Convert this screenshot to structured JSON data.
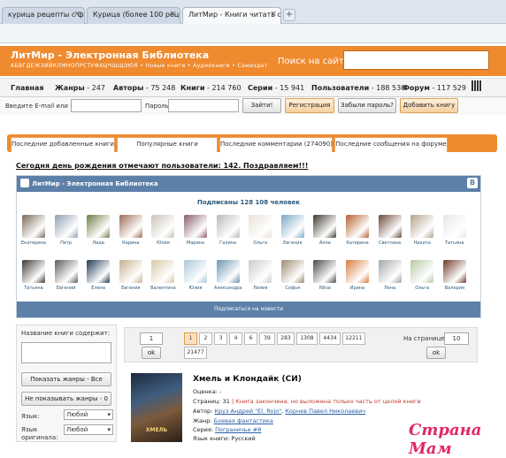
{
  "browser": {
    "tabs": [
      {
        "title": "курица рецепты с фото"
      },
      {
        "title": "Курица (более 100 рецеп"
      },
      {
        "title": "ЛитМир - Книги читать он"
      }
    ],
    "new_tab": "+"
  },
  "site": {
    "title": "ЛитМир - Электронная Библиотека",
    "subtitle": "АБВГДЕЖЗИЙКЛМНОПРСТУФХЦЧШЩЭЮЯ  •  Новые книги  •  Аудиокниги  •  Самиздат",
    "search_label": "Поиск на сайте",
    "search_value": ""
  },
  "nav": {
    "home": "Главная",
    "genres": "Жанры",
    "genres_count": "247",
    "authors": "Авторы",
    "authors_count": "75 248",
    "books": "Книги",
    "books_count": "214 760",
    "series": "Серии",
    "series_count": "15 941",
    "users": "Пользователи",
    "users_count": "188 530",
    "forum": "Форум",
    "forum_count": "117 529"
  },
  "login": {
    "email_label": "Введите E-mail или ID:",
    "password_label": "Пароль:",
    "enter": "Зайти!",
    "register": "Регистрация",
    "forgot": "Забыли пароль?",
    "add_book": "Добавить книгу"
  },
  "section_tabs": [
    "Последние добавленные книги",
    "Популярные книги",
    "Последние комментарии (274090)",
    "Последние сообщения на форуме"
  ],
  "birthday": "Сегодня день рождения отмечают пользователи: 142. Поздравляем!!!",
  "widget": {
    "title": "ЛитМир - Электронная Библиотека",
    "badge": "B",
    "subscribers": "Подписаны 128 108 человек",
    "row1": [
      "Екатерина",
      "Петр",
      "Лида",
      "Карина",
      "Юлия",
      "Марина",
      "Галина",
      "Ольга",
      "Евгения",
      "Алла",
      "Катерина",
      "Светлана",
      "Никита",
      "Татьяна"
    ],
    "row2": [
      "Татьяна",
      "Евгений",
      "Елена",
      "Евгения",
      "Валентина",
      "Юлия",
      "Александра",
      "Лилия",
      "Софья",
      "Nitsa",
      "Ирина",
      "Лена",
      "Ольга",
      "Валерия"
    ],
    "subscribe_button": "Подписаться на новости",
    "colors1": [
      "#7a6a58",
      "#8fa0b5",
      "#6f7f46",
      "#9c6b55",
      "#c9c3b8",
      "#8a5d72",
      "#b9b9b9",
      "#e8e0d6",
      "#7ba8c8",
      "#3f3a2e",
      "#b7602f",
      "#6b4a3b",
      "#b2a28c",
      "#e4e7ea"
    ],
    "colors2": [
      "#3d3a36",
      "#5c5b58",
      "#1f3a52",
      "#c8b08e",
      "#d6c8a6",
      "#a8c6d8",
      "#6d93b0",
      "#c8ccd0",
      "#9d8b6e",
      "#4a4a4a",
      "#d87b3f",
      "#a1a5a8",
      "#b5c9a4",
      "#6f3c2b"
    ]
  },
  "filter": {
    "title_label": "Название книги содержит:",
    "show_genres": "Показать жанры - Все",
    "hide_genres": "Не показывать жанры - 0",
    "lang_label": "Язык:",
    "lang_value": "Любой",
    "orig_label": "Язык оригинала:",
    "orig_value": "Любой"
  },
  "pager": {
    "page_input": "1",
    "ok": "ok",
    "pages": [
      "1",
      "2",
      "3",
      "4",
      "6",
      "39",
      "283",
      "1308",
      "4434",
      "12211"
    ],
    "extra_page": "21477",
    "per_page_label": "На странице:",
    "per_page_value": "10",
    "ok2": "ok"
  },
  "book": {
    "title": "Хмель и Клондайк (СИ)",
    "rating_label": "Оценка:",
    "rating_value": "-",
    "pages_label": "Страниц:",
    "pages_value": "31",
    "pages_note": "| Книга закончена, но выложена только часть от целой книги",
    "author_label": "Автор:",
    "author1": "Круз Андрей \"El. Rojo\"",
    "author2": "Корнев Павел Николаевич",
    "genre_label": "Жанр:",
    "genre_value": "Боевая фантастика",
    "series_label": "Серия:",
    "series_value": "Пограничье #8",
    "lang_label": "Язык книги:",
    "lang_value": "Русский",
    "cover_text": "ХМЕЛЬ"
  },
  "watermark": "Страна Мам"
}
